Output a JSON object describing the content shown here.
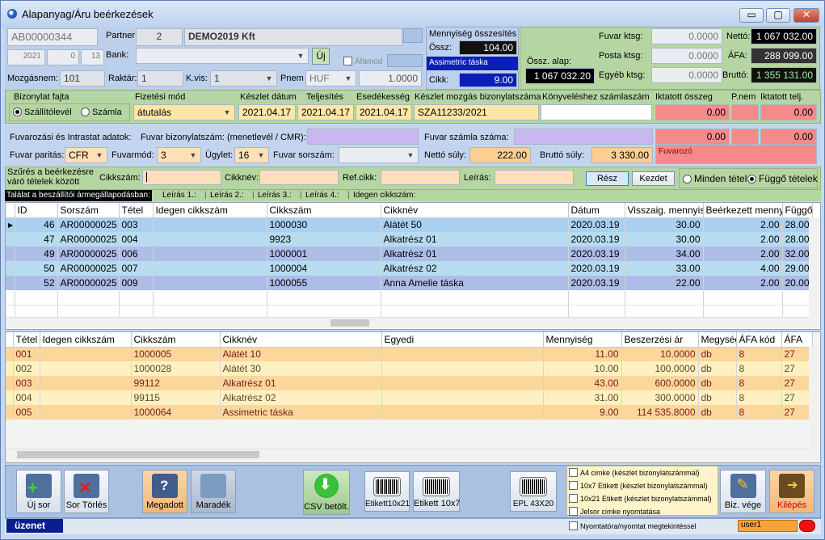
{
  "window": {
    "title": "Alapanyag/Áru beérkezések",
    "min": "▭",
    "max": "▢",
    "close": "✕"
  },
  "header": {
    "doc_id": "AB00000344",
    "partner_label": "Partner",
    "partner_code": "2",
    "partner_name": "DEMO2019 Kft",
    "year": "2021",
    "num1": "0",
    "num2": "13",
    "bank_label": "Bank:",
    "uj_label": "Új",
    "afamod_label": "Áfamód",
    "mozgasnem_label": "Mozgásnem:",
    "mozgasnem": "101",
    "raktar_label": "Raktár:",
    "raktar": "1",
    "kvis_label": "K.vis:",
    "kvis": "1",
    "pnem_label": "Pnem",
    "pnem": "HUF",
    "rate": "1.0000"
  },
  "summary": {
    "title": "Mennyiség összesítés",
    "ossz_label": "Össz:",
    "ossz": "104.00",
    "item_name": "Assimetric táska",
    "cikk_label": "Cikk:",
    "cikk": "9.00"
  },
  "costs": {
    "fuvar_label": "Fuvar ktsg:",
    "fuvar": "0.0000",
    "posta_label": "Posta ktsg:",
    "posta": "0.0000",
    "egyeb_label": "Egyéb ktsg:",
    "egyeb": "0.0000",
    "osszalap_label": "Össz. alap:",
    "osszalap": "1 067 032.20",
    "netto_label": "Nettó:",
    "netto": "1 067 032.00",
    "afa_label": "ÁFA:",
    "afa": "288 099.00",
    "brutto_label": "Bruttó:",
    "brutto": "1 355 131.00"
  },
  "docrow": {
    "fajta_label": "Bizonylat fajta",
    "opt1": "Szállítólevél",
    "opt2": "Számla",
    "fizmod_label": "Fizetési mód",
    "fizmod": "átutalás",
    "kdatum_label": "Készlet dátum",
    "kdatum": "2021.04.17",
    "telj_label": "Teljesítés",
    "telj": "2021.04.17",
    "esed_label": "Esedékesség",
    "esed": "2021.04.17",
    "kmozg_label": "Készlet mozgás bizonylatszáma",
    "kmozg": "SZA11233/2021",
    "konyv_label": "Könyveléshez számlaszám",
    "iktato_label": "Iktatott összeg",
    "iktato": "0.00",
    "pnem_label": "P.nem",
    "iktelj_label": "Iktatott telj.",
    "iktelj": "0.00"
  },
  "transport": {
    "title": "Fuvarozási és Intrastat adatok:",
    "biz_label": "Fuvar bizonylatszám: (menetlevél / CMR):",
    "szamla_label": "Fuvar számla száma:",
    "v1": "0.00",
    "v2": "0.00",
    "paritas_label": "Fuvar paritás:",
    "paritas": "CFR",
    "fuvarmod_label": "Fuvarmód:",
    "fuvarmod": "3",
    "ugylet_label": "Ügylet:",
    "ugylet": "16",
    "sorszam_label": "Fuvar sorszám:",
    "netto_suly_label": "Nettó súly:",
    "netto_suly": "222.00",
    "brutto_suly_label": "Bruttó súly:",
    "brutto_suly": "3 330.00",
    "fuvarozo_label": "Fuvarozó"
  },
  "filter": {
    "title1": "Szűrés a beérkezésre",
    "title2": "váró tételek között",
    "cikkszam_label": "Cikkszám:",
    "cikknev_label": "Cikknév:",
    "refcikk_label": "Ref.cikk:",
    "leiras_label": "Leírás:",
    "resz": "Rész",
    "kezdet": "Kezdet",
    "minden": "Minden tétel",
    "fuggo": "Függő tételek"
  },
  "hint": {
    "text": "Találat a beszállítói ármegállapodásban:",
    "l1": "Leírás 1.:",
    "l2": "Leírás 2.:",
    "l3": "Leírás 3.:",
    "l4": "Leírás 4.:",
    "idegen": "Idegen cikkszám:"
  },
  "grid1": {
    "headers": [
      "ID",
      "Sorszám",
      "Tétel",
      "Idegen cikkszám",
      "Cikkszám",
      "Cikknév",
      "Dátum",
      "Visszaig. mennyiség",
      "Beérkezett mennyiség",
      "Függő"
    ],
    "rows": [
      [
        "46",
        "AR00000025",
        "003",
        "",
        "1000030",
        "Alátét 50",
        "2020.03.19",
        "30.00",
        "2.00",
        "28.00"
      ],
      [
        "47",
        "AR00000025",
        "004",
        "",
        "9923",
        "Alkatrész 01",
        "2020.03.19",
        "30.00",
        "2.00",
        "28.00"
      ],
      [
        "49",
        "AR00000025",
        "006",
        "",
        "1000001",
        "Alkatrész 01",
        "2020.03.19",
        "34.00",
        "2.00",
        "32.00"
      ],
      [
        "50",
        "AR00000025",
        "007",
        "",
        "1000004",
        "Alkatrész 02",
        "2020.03.19",
        "33.00",
        "4.00",
        "29.00"
      ],
      [
        "52",
        "AR00000025",
        "009",
        "",
        "1000055",
        "Anna Amelie táska",
        "2020.03.19",
        "22.00",
        "2.00",
        "20.00"
      ]
    ]
  },
  "grid2": {
    "headers": [
      "Tétel",
      "Idegen cikkszám",
      "Cikkszám",
      "Cikknév",
      "Egyedi",
      "Mennyiség",
      "Beszerzési ár",
      "Megység",
      "ÁFA kód",
      "ÁFA"
    ],
    "rows": [
      [
        "001",
        "",
        "1000005",
        "Alátét 10",
        "",
        "11.00",
        "10.0000",
        "db",
        "8",
        "27"
      ],
      [
        "002",
        "",
        "1000028",
        "Alátét 30",
        "",
        "10.00",
        "100.0000",
        "db",
        "8",
        "27"
      ],
      [
        "003",
        "",
        "99112",
        "Alkatrész 01",
        "",
        "43.00",
        "600.0000",
        "db",
        "8",
        "27"
      ],
      [
        "004",
        "",
        "99115",
        "Alkatrész 02",
        "",
        "31.00",
        "300.0000",
        "db",
        "8",
        "27"
      ],
      [
        "005",
        "",
        "1000064",
        "Assimetric táska",
        "",
        "9.00",
        "114 535.8000",
        "db",
        "8",
        "27"
      ]
    ]
  },
  "toolbar": {
    "uj_sor": "Új sor",
    "sor_torles": "Sor Törlés",
    "megadott": "Megadott",
    "maradek": "Maradék",
    "csv": "CSV betölt.",
    "etikett1": "Etikett10x21",
    "etikett2": "Etikett 10x7",
    "epl": "EPL 43X20",
    "biz_vege": "Biz. vége",
    "kilepes": "Kilépés",
    "chk1": "A4 cimke (készlet bizonylatszámmal)",
    "chk2": "10x7 Etikett (készlet bizonylatszámmal)",
    "chk3": "10x21 Etikett (készlet bizonylatszámmal)",
    "chk4": "Jelsor cimke nyomtatása",
    "chk5": "Nyomtatóra/nyomtat megtekintéssel",
    "status": "üzenet",
    "user": "user1"
  }
}
